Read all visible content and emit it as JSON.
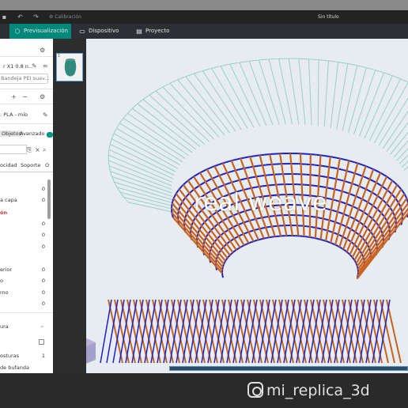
{
  "window": {
    "title": "Sin título",
    "calibration_label": "Calibración"
  },
  "tabs": [
    {
      "label": "Previsualización",
      "icon": "cube-icon",
      "active": true
    },
    {
      "label": "Dispositivo",
      "icon": "monitor-icon",
      "active": false
    },
    {
      "label": "Proyecto",
      "icon": "project-icon",
      "active": false
    }
  ],
  "sidebar": {
    "printer_name": "r X1 0.8 n...",
    "plate_type": "Bandeja PEI suav...",
    "filament": "PLA - mío",
    "mode_objects": "Objetos",
    "mode_advanced": "Avanzado",
    "settings_tabs": [
      "ocidad",
      "Soporte",
      "O"
    ],
    "rows": [
      {
        "label": "",
        "value": "0"
      },
      {
        "label": "a capa",
        "value": "0"
      },
      {
        "label": "ón",
        "value": ""
      },
      {
        "label": "",
        "value": "0"
      },
      {
        "label": "",
        "value": "0"
      },
      {
        "label": "",
        "value": "0"
      },
      {
        "label": "erior",
        "value": "0"
      },
      {
        "label": "o",
        "value": "0"
      },
      {
        "label": "rno",
        "value": "0"
      },
      {
        "label": "",
        "value": "0"
      }
    ],
    "bottom_rows": [
      {
        "label": "ura",
        "value": ""
      },
      {
        "label": "",
        "value": ""
      },
      {
        "label": "osturas",
        "value": "1"
      },
      {
        "label": "de bufanda",
        "value": ""
      }
    ]
  },
  "viewport": {
    "overlay_text": "real weave",
    "thumbnail_number": "1"
  },
  "watermark": {
    "text": "mi_replica_3d"
  },
  "colors": {
    "accent": "#00897b",
    "weave_blue": "#1c22c8",
    "weave_orange": "#c9631f",
    "ghost_teal": "#86c9bd"
  }
}
